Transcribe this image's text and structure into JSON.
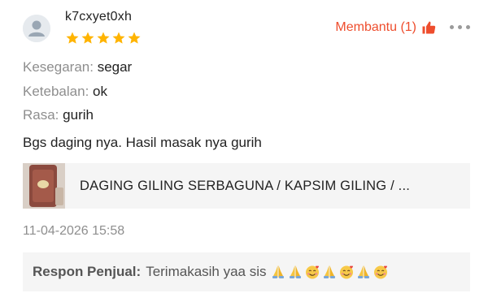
{
  "review": {
    "username": "k7cxyet0xh",
    "rating": 5,
    "max_rating": 5,
    "helpful_label": "Membantu (1)",
    "attributes": [
      {
        "key": "Kesegaran:",
        "value": "segar"
      },
      {
        "key": "Ketebalan:",
        "value": "ok"
      },
      {
        "key": "Rasa:",
        "value": "gurih"
      }
    ],
    "comment": "Bgs daging nya. Hasil masak nya gurih",
    "product_name": "DAGING GILING SERBAGUNA / KAPSIM GILING / ...",
    "timestamp": "11-04-2026 15:58",
    "seller_response": {
      "label": "Respon Penjual:",
      "text": "Terimakasih yaa sis",
      "emoji_sequence": [
        "folded-hands",
        "folded-hands",
        "smiling-face-with-hearts",
        "folded-hands",
        "smiling-face-with-hearts",
        "folded-hands",
        "smiling-face-with-hearts"
      ]
    }
  },
  "colors": {
    "accent": "#ee4d2d",
    "star": "#ffb400",
    "muted_text": "#8e8e8e",
    "panel_bg": "#f5f5f5"
  },
  "icons": {
    "avatar": "user-avatar-icon",
    "star": "star-icon",
    "thumb": "thumbs-up-icon",
    "more": "more-options-icon"
  }
}
